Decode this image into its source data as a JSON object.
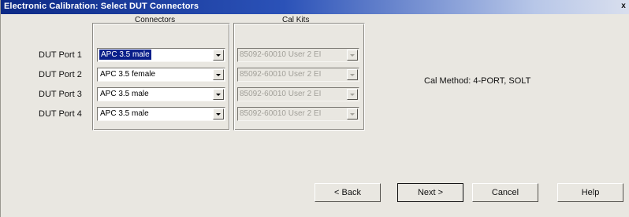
{
  "window": {
    "title": "Electronic Calibration: Select DUT Connectors",
    "close_glyph": "x"
  },
  "columns": {
    "connectors": "Connectors",
    "cal_kits": "Cal Kits"
  },
  "ports": [
    {
      "label": "DUT Port 1",
      "connector": "APC 3.5 male",
      "cal_kit": "85092-60010 User 2 EI",
      "connector_selected": true
    },
    {
      "label": "DUT Port 2",
      "connector": "APC 3.5 female",
      "cal_kit": "85092-60010 User 2 EI"
    },
    {
      "label": "DUT Port 3",
      "connector": "APC 3.5 male",
      "cal_kit": "85092-60010 User 2 EI"
    },
    {
      "label": "DUT Port 4",
      "connector": "APC 3.5 male",
      "cal_kit": "85092-60010 User 2 EI"
    }
  ],
  "cal_method": "Cal Method: 4-PORT, SOLT",
  "buttons": {
    "back": "< Back",
    "next": "Next >",
    "cancel": "Cancel",
    "help": "Help"
  },
  "colors": {
    "title_start": "#0d2a86",
    "title_end": "#d9dfee",
    "selection": "#0a1f8a",
    "dialog_bg": "#e9e7e1"
  }
}
